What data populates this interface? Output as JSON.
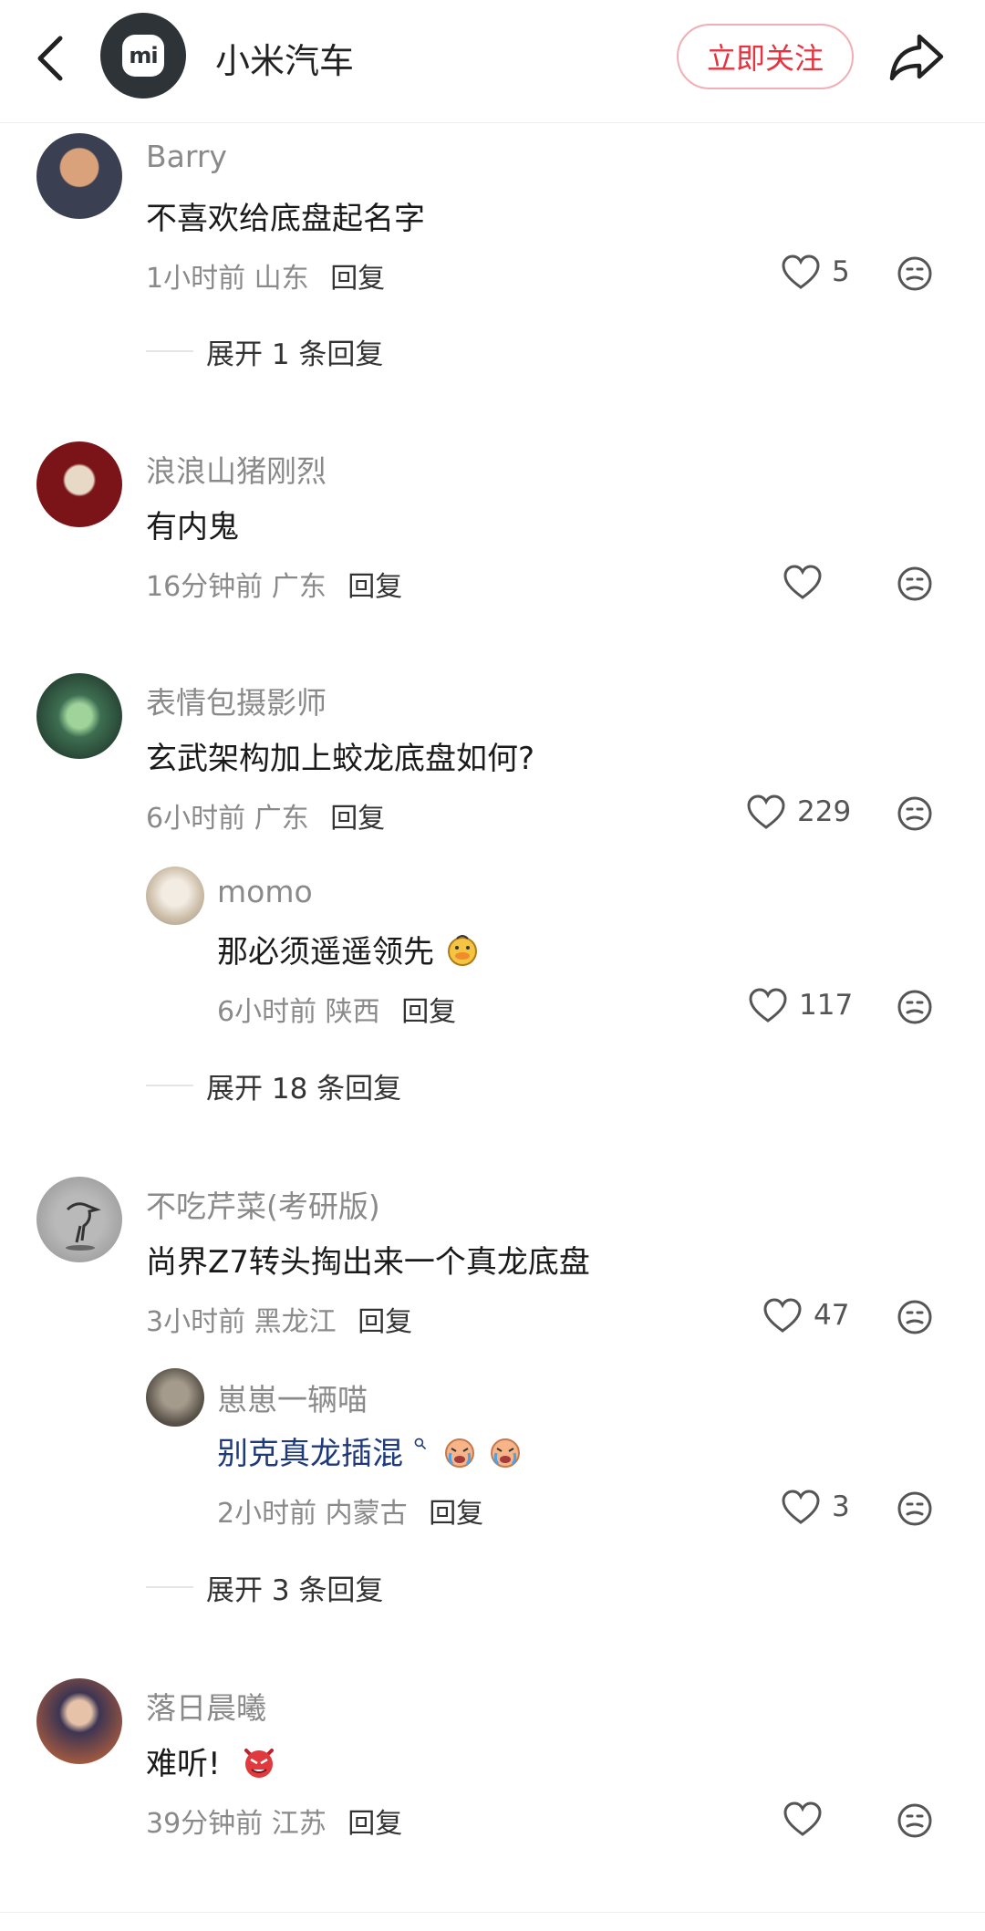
{
  "header": {
    "brand_name": "小米汽车",
    "logo_text": "mi",
    "follow_label": "立即关注"
  },
  "comments": [
    {
      "username": "Barry",
      "text": "不喜欢给底盘起名字",
      "time": "1小时前",
      "location": "山东",
      "reply_label": "回复",
      "likes": "5",
      "expand_label": "展开 1 条回复"
    },
    {
      "username": "浪浪山猪刚烈",
      "text": "有内鬼",
      "time": "16分钟前",
      "location": "广东",
      "reply_label": "回复",
      "likes": ""
    },
    {
      "username": "表情包摄影师",
      "text": "玄武架构加上蛟龙底盘如何?",
      "time": "6小时前",
      "location": "广东",
      "reply_label": "回复",
      "likes": "229",
      "reply": {
        "username": "momo",
        "text": "那必须遥遥领先",
        "time": "6小时前",
        "location": "陕西",
        "reply_label": "回复",
        "likes": "117"
      },
      "expand_label": "展开 18 条回复"
    },
    {
      "username": "不吃芹菜(考研版)",
      "text": "尚界Z7转头掏出来一个真龙底盘",
      "time": "3小时前",
      "location": "黑龙江",
      "reply_label": "回复",
      "likes": "47",
      "reply": {
        "username": "崽崽一辆喵",
        "text": "别克真龙插混",
        "time": "2小时前",
        "location": "内蒙古",
        "reply_label": "回复",
        "likes": "3"
      },
      "expand_label": "展开 3 条回复"
    },
    {
      "username": "落日晨曦",
      "text": "难听!",
      "time": "39分钟前",
      "location": "江苏",
      "reply_label": "回复",
      "likes": ""
    }
  ],
  "icons": {
    "back": "chevron-left-icon",
    "share": "share-icon",
    "like": "heart-icon",
    "emoji": "emoji-face-icon"
  },
  "colors": {
    "accent": "#e5333f",
    "link_text": "#1f3a7a",
    "meta_text": "#8a8a8a"
  }
}
